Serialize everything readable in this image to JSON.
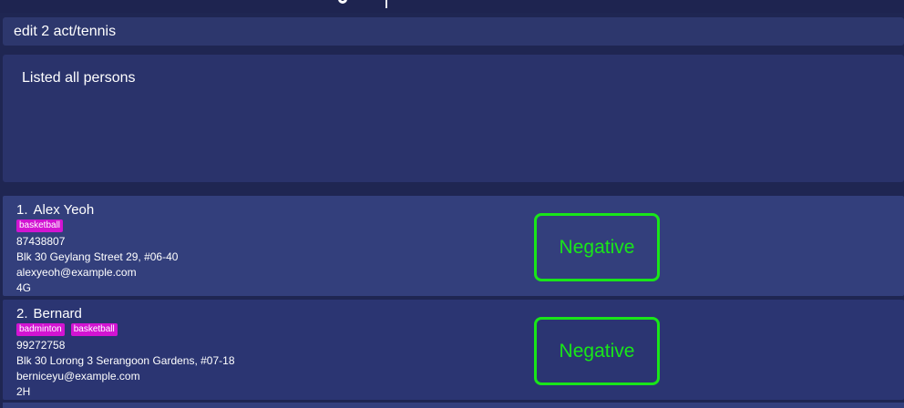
{
  "command": {
    "value": "edit 2 act/tennis"
  },
  "result": {
    "message": "Listed all persons"
  },
  "persons": [
    {
      "index": "1.",
      "name": "Alex Yeoh",
      "tags": [
        "basketball"
      ],
      "phone": "87438807",
      "address": "Blk 30 Geylang Street 29, #06-40",
      "email": "alexyeoh@example.com",
      "class": "4G",
      "status": "Negative"
    },
    {
      "index": "2.",
      "name": "Bernard",
      "tags": [
        "badminton",
        "basketball"
      ],
      "phone": "99272758",
      "address": "Blk 30 Lorong 3 Serangoon Gardens, #07-18",
      "email": "berniceyu@example.com",
      "class": "2H",
      "status": "Negative"
    }
  ],
  "colors": {
    "background": "#1f2652",
    "card": "#333f7c",
    "card_alt": "#2b3572",
    "tag": "#d214d2",
    "negative_status": "#19e619"
  }
}
